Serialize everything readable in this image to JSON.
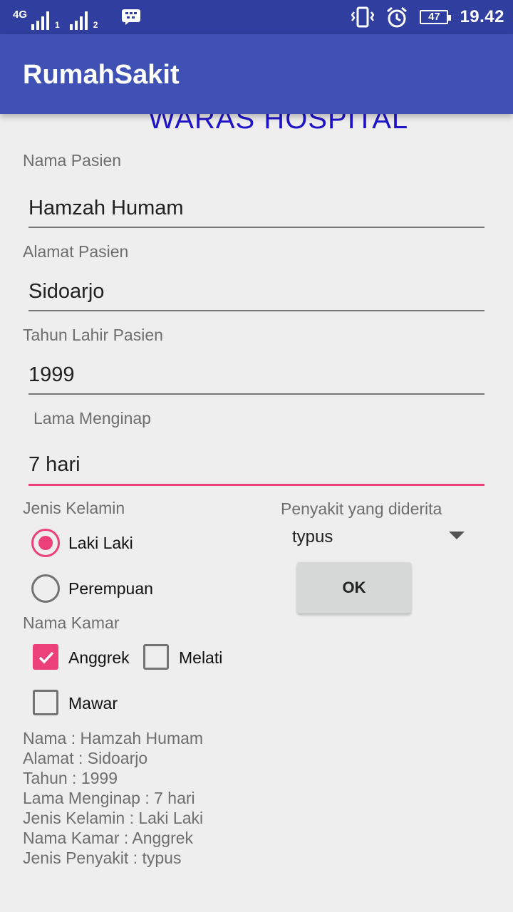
{
  "status_bar": {
    "network": "4G",
    "sim1": "1",
    "sim2": "2",
    "battery": "47",
    "time": "19.42",
    "icons": [
      "signal-icon",
      "bbm-icon",
      "vibrate-icon",
      "alarm-icon",
      "battery-icon"
    ]
  },
  "app_bar": {
    "title": "RumahSakit"
  },
  "header_banner": "WARAS HOSPITAL",
  "form": {
    "nama_label": "Nama Pasien",
    "nama_value": "Hamzah Humam",
    "alamat_label": "Alamat Pasien",
    "alamat_value": "Sidoarjo",
    "tahun_label": "Tahun Lahir Pasien",
    "tahun_value": "1999",
    "lama_label": "Lama Menginap",
    "lama_value": "7 hari",
    "gender_label": "Jenis Kelamin",
    "gender_options": [
      "Laki Laki",
      "Perempuan"
    ],
    "gender_selected": "Laki Laki",
    "penyakit_label": "Penyakit yang diderita",
    "penyakit_value": "typus",
    "ok_label": "OK",
    "kamar_label": "Nama Kamar",
    "kamar_options": [
      "Anggrek",
      "Melati",
      "Mawar"
    ],
    "kamar_checked": [
      "Anggrek"
    ]
  },
  "summary": [
    "Nama : Hamzah Humam",
    "Alamat : Sidoarjo",
    "Tahun : 1999",
    "Lama Menginap : 7 hari",
    "Jenis Kelamin : Laki Laki",
    "Nama Kamar : Anggrek",
    "Jenis Penyakit : typus"
  ],
  "colors": {
    "status_bar": "#303f9f",
    "app_bar": "#3f51b5",
    "accent": "#ec407a",
    "banner_text": "#2014c8"
  }
}
